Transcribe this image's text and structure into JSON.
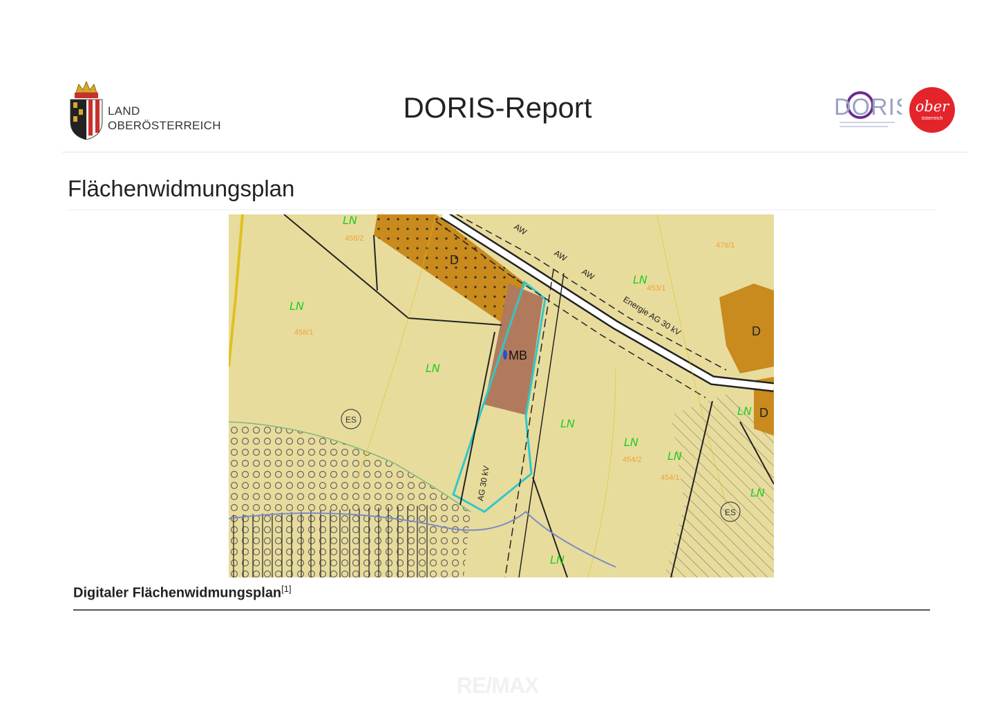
{
  "header": {
    "logo_line1": "LAND",
    "logo_line2": "OBERÖSTERREICH",
    "title": "DORIS-Report",
    "doris_logo_text": "DORIS",
    "ober_logo_text": "ober",
    "ober_logo_sub": "österreich"
  },
  "section": {
    "title": "Flächenwidmungsplan"
  },
  "map": {
    "colors": {
      "grassland": "#e8dc9d",
      "village": "#c98a1e",
      "mixed_building": "#b27a5c",
      "parcel_outline": "#2ec8c8",
      "line_label_green": "#22cc22",
      "parcel_number": "#f0a23a"
    },
    "labels": {
      "ln": "LN",
      "d": "D",
      "mb": "MB",
      "es": "ES",
      "aw": "AW",
      "energie": "Energie AG 30 kV",
      "ag_vertical": "AG 30 kV"
    },
    "parcels": {
      "p1": "458/2",
      "p2": "458/1",
      "p3": "476/1",
      "p4": "453/1",
      "p5": "454/2",
      "p6": "454/1"
    }
  },
  "caption": {
    "text": "Digitaler Flächenwidmungsplan",
    "footnote": "[1]"
  },
  "watermark": "RE/MAX"
}
